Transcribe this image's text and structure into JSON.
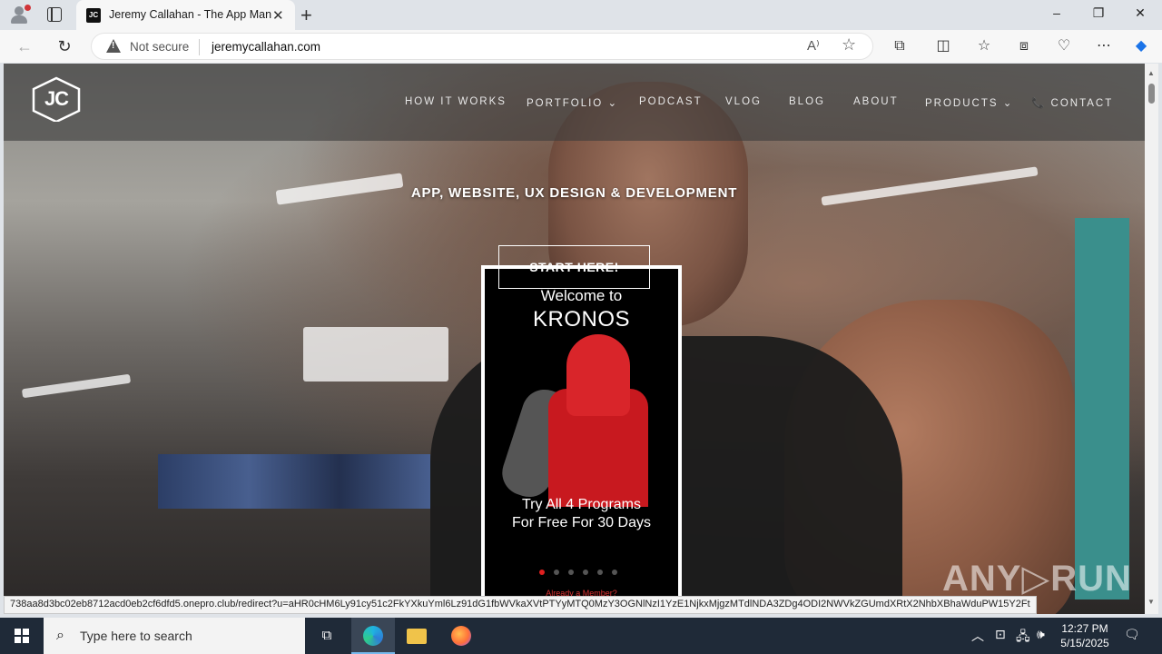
{
  "browser": {
    "tab_title": "Jeremy Callahan - The App Man",
    "tab_favicon_text": "JC",
    "security_label": "Not secure",
    "url": "jeremycallahan.com",
    "window_controls": {
      "minimize": "–",
      "restore": "❐",
      "close": "✕"
    },
    "status_url": "738aa8d3bc02eb8712acd0eb2cf6dfd5.onepro.club/redirect?u=aHR0cHM6Ly91cy51c2FkYXkuYml6Lz91dG1fbWVkaXVtPTYyMTQ0MzY3OGNlNzI1YzE1NjkxMjgzMTdlNDA3ZDg4ODI2NWVkZGUmdXRtX2NhbXBhaWduPW15Y2Ft"
  },
  "site": {
    "logo_text": "JC",
    "nav": [
      {
        "label": "HOW IT WORKS"
      },
      {
        "label": "PORTFOLIO ⌄"
      },
      {
        "label": "PODCAST"
      },
      {
        "label": "VLOG"
      },
      {
        "label": "BLOG"
      },
      {
        "label": "ABOUT"
      },
      {
        "label": "PRODUCTS ⌄"
      },
      {
        "label": "📞 CONTACT"
      }
    ],
    "tagline": "APP, WEBSITE, UX DESIGN & DEVELOPMENT",
    "cta_label": "START HERE!"
  },
  "promo": {
    "welcome": "Welcome to",
    "brand": "KRONOS",
    "offer_line1": "Try All 4 Programs",
    "offer_line2": "For Free For 30 Days",
    "member_text": "Already a Member?"
  },
  "watermark": "ANY▷RUN",
  "taskbar": {
    "search_placeholder": "Type here to search",
    "time": "12:27 PM",
    "date": "5/15/2025"
  },
  "colors": {
    "brand_red": "#d9252a",
    "taskbar": "#1f2a38",
    "chrome_bg": "#dfe3e8"
  }
}
